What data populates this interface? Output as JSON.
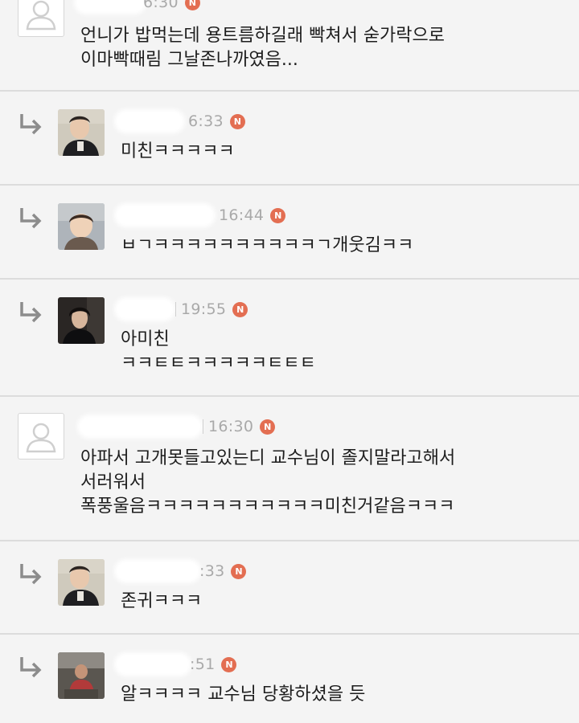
{
  "comments": [
    {
      "time": "6:30",
      "badge": "N",
      "avatar": "default-person-icon",
      "lines": [
        "언니가 밥먹는데 용트름하길래 빡쳐서 숟가락으로",
        "이마빡때림 그날존나까였음..."
      ]
    },
    {
      "time": "6:33",
      "badge": "N",
      "avatar": "user-photo",
      "lines": [
        "미친ㅋㅋㅋㅋㅋ"
      ]
    },
    {
      "time": "16:44",
      "badge": "N",
      "avatar": "user-photo",
      "lines": [
        "ㅂㄱㅋㅋㅋㅋㅋㅋㅋㅋㅋㅋㄱ개웃김ㅋㅋ"
      ]
    },
    {
      "time": "19:55",
      "badge": "N",
      "avatar": "user-photo",
      "lines": [
        "아미친",
        "ㅋㅋㅌㅌㅋㅋㅋㅋㅋㅌㅌㅌ"
      ]
    },
    {
      "time": "16:30",
      "badge": "N",
      "avatar": "default-person-icon",
      "lines": [
        "아파서 고개못들고있는디 교수님이 졸지말라고해서",
        "서러워서",
        "폭풍울음ㅋㅋㅋㅋㅋㅋㅋㅋㅋㅋㅋ미친거같음ㅋㅋㅋ"
      ]
    },
    {
      "time": ":33",
      "badge": "N",
      "avatar": "user-photo",
      "lines": [
        "존귀ㅋㅋㅋ"
      ]
    },
    {
      "time": ":51",
      "badge": "N",
      "avatar": "user-photo",
      "lines": [
        "알ㅋㅋㅋㅋ 교수님 당황하셨을 듯"
      ]
    }
  ],
  "icons": {
    "reply": "reply-arrow-icon",
    "default_avatar": "person-silhouette-icon",
    "new_badge_color": "#e36e52"
  }
}
